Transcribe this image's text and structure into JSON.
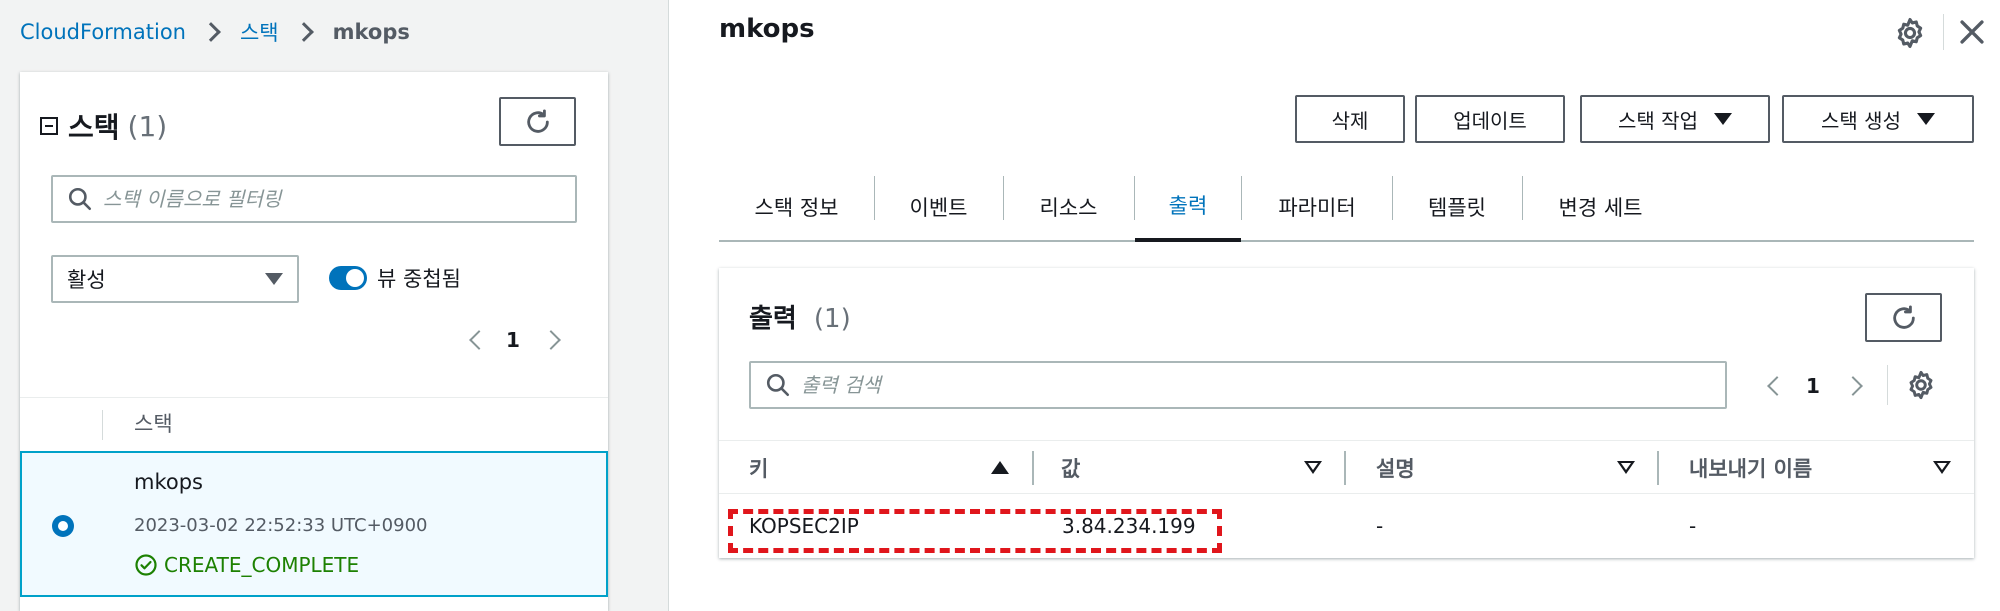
{
  "breadcrumb": {
    "items": [
      "CloudFormation",
      "스택"
    ],
    "current": "mkops"
  },
  "stack_list": {
    "title": "스택",
    "count": "(1)",
    "filter_placeholder": "스택 이름으로 필터링",
    "status_filter": "활성",
    "nested_toggle_label": "뷰 중첩됨",
    "page": "1",
    "column_header": "스택",
    "rows": [
      {
        "name": "mkops",
        "timestamp": "2023-03-02 22:52:33 UTC+0900",
        "status": "CREATE_COMPLETE"
      }
    ]
  },
  "detail": {
    "title": "mkops",
    "actions": {
      "delete": "삭제",
      "update": "업데이트",
      "stack_actions": "스택 작업",
      "create_stack": "스택 생성"
    },
    "tabs": [
      "스택 정보",
      "이벤트",
      "리소스",
      "출력",
      "파라미터",
      "템플릿",
      "변경 세트"
    ],
    "active_tab": "출력"
  },
  "outputs": {
    "title": "출력",
    "count": "(1)",
    "search_placeholder": "출력 검색",
    "page": "1",
    "columns": [
      "키",
      "값",
      "설명",
      "내보내기 이름"
    ],
    "rows": [
      {
        "key": "KOPSEC2IP",
        "value": "3.84.234.199",
        "description": "-",
        "export_name": "-"
      }
    ]
  },
  "colors": {
    "link": "#0073bb",
    "success": "#1d8102",
    "selected_row_bg": "#f1faff",
    "selected_row_border": "#00a1c9",
    "highlight": "#e0161c"
  },
  "icons": [
    "refresh-icon",
    "search-icon",
    "gear-icon",
    "close-icon",
    "check-circle-icon",
    "caret-down-icon",
    "sort-ascending-icon",
    "sort-descending-icon"
  ]
}
